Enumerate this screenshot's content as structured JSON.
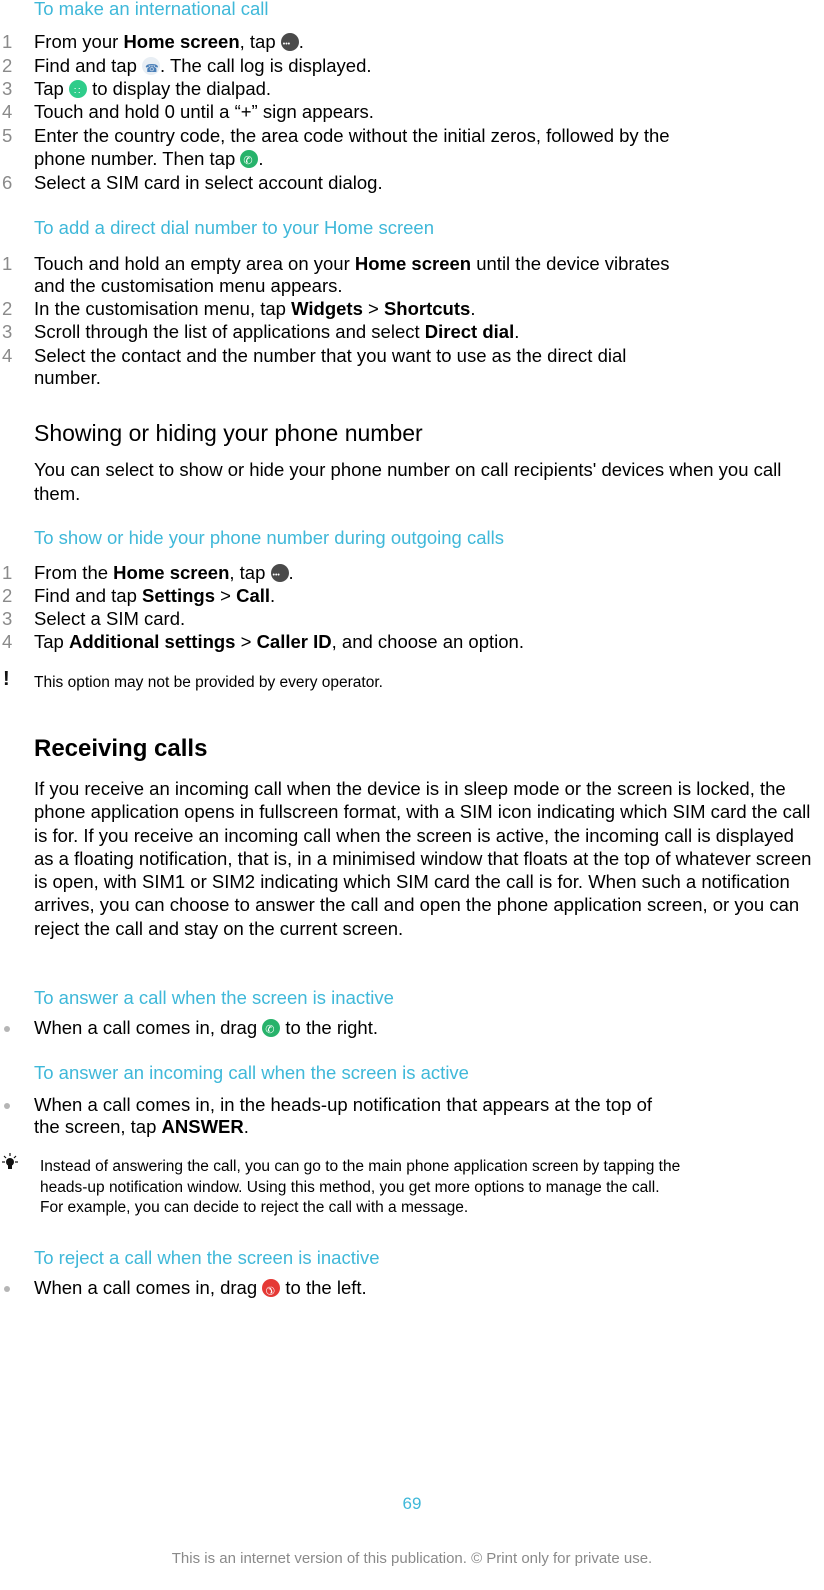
{
  "sections": {
    "intl_call": {
      "title": "To make an international call",
      "steps": [
        {
          "n": "1",
          "pre": "From your ",
          "bold": "Home screen",
          "post": ", tap ",
          "icon": "apps-icon",
          "end": "."
        },
        {
          "n": "2",
          "pre": "Find and tap ",
          "icon": "call-log-icon",
          "end": ". The call log is displayed."
        },
        {
          "n": "3",
          "pre": "Tap ",
          "icon": "dialpad-icon",
          "end": " to display the dialpad."
        },
        {
          "n": "4",
          "text": "Touch and hold 0 until a “+” sign appears."
        },
        {
          "n": "5",
          "line1": "Enter the country code, the area code without the initial zeros, followed by the",
          "line2_pre": "phone number. Then tap ",
          "icon": "call-icon",
          "end": "."
        },
        {
          "n": "6",
          "text": "Select a SIM card in select account dialog."
        }
      ]
    },
    "direct_dial": {
      "title": "To add a direct dial number to your Home screen",
      "steps": [
        {
          "n": "1",
          "pre": "Touch and hold an empty area on your ",
          "bold": "Home screen",
          "post": " until the device vibrates",
          "line2": "and the customisation menu appears."
        },
        {
          "n": "2",
          "pre": "In the customisation menu, tap ",
          "bold": "Widgets",
          "mid": " > ",
          "bold2": "Shortcuts",
          "end": "."
        },
        {
          "n": "3",
          "pre": "Scroll through the list of applications and select ",
          "bold": "Direct dial",
          "end": "."
        },
        {
          "n": "4",
          "line1": "Select the contact and the number that you want to use as the direct dial",
          "line2": "number."
        }
      ]
    },
    "show_hide": {
      "heading": "Showing or hiding your phone number",
      "body": "You can select to show or hide your phone number on call recipients' devices when you call them.",
      "title": "To show or hide your phone number during outgoing calls",
      "steps": [
        {
          "n": "1",
          "pre": "From the ",
          "bold": "Home screen",
          "post": ", tap ",
          "icon": "apps-icon",
          "end": "."
        },
        {
          "n": "2",
          "pre": "Find and tap ",
          "bold": "Settings",
          "mid": " > ",
          "bold2": "Call",
          "end": "."
        },
        {
          "n": "3",
          "text": "Select a SIM card."
        },
        {
          "n": "4",
          "pre": "Tap ",
          "bold": "Additional settings",
          "mid": " > ",
          "bold2": "Caller ID",
          "end": ", and choose an option."
        }
      ],
      "note": "This option may not be provided by every operator."
    },
    "receiving": {
      "heading": "Receiving calls",
      "body": "If you receive an incoming call when the device is in sleep mode or the screen is locked, the phone application opens in fullscreen format, with a SIM icon indicating which SIM card the call is for. If you receive an incoming call when the screen is active, the incoming call is displayed as a floating notification, that is, in a minimised window that floats at the top of whatever screen is open, with SIM1 or SIM2 indicating which SIM card the call is for. When such a notification arrives, you can choose to answer the call and open the phone application screen, or you can reject the call and stay on the current screen.",
      "answer_inactive": {
        "title": "To answer a call when the screen is inactive",
        "pre": "When a call comes in, drag ",
        "end": " to the right."
      },
      "answer_active": {
        "title": "To answer an incoming call when the screen is active",
        "line1": "When a call comes in, in the heads-up notification that appears at the top of",
        "line2_pre": "the screen, tap ",
        "bold": "ANSWER",
        "end": "."
      },
      "tip": [
        "Instead of answering the call, you can go to the main phone application screen by tapping the",
        "heads-up notification window. Using this method, you get more options to manage the call.",
        "For example, you can decide to reject the call with a message."
      ],
      "reject_inactive": {
        "title": "To reject a call when the screen is inactive",
        "pre": "When a call comes in, drag ",
        "end": " to the left."
      }
    }
  },
  "footer": {
    "page_number": "69",
    "notice": "This is an internet version of this publication. © Print only for private use."
  },
  "colors": {
    "accent": "#3fb8d9",
    "text": "#000000",
    "muted": "#8a8a8a"
  }
}
